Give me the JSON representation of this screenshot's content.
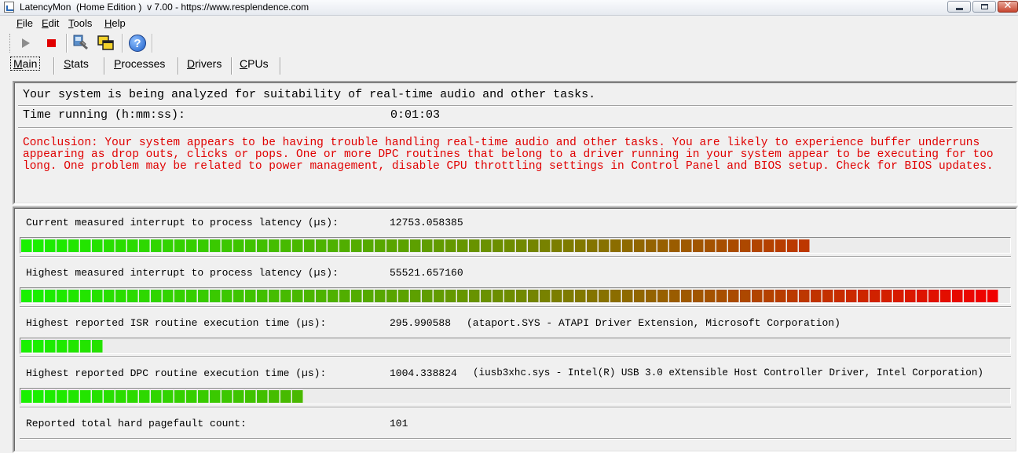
{
  "window": {
    "title": "LatencyMon  (Home Edition )  v 7.00 - https://www.resplendence.com",
    "controls": {
      "minimize": "minimize",
      "maximize": "maximize",
      "close": "✕"
    }
  },
  "menu": {
    "file": {
      "accel": "F",
      "rest": "ile"
    },
    "edit": {
      "accel": "E",
      "rest": "dit"
    },
    "tools": {
      "accel": "T",
      "rest": "ools"
    },
    "help": {
      "accel": "H",
      "rest": "elp"
    }
  },
  "toolbar": {
    "icons": [
      "play-icon",
      "stop-icon",
      "system-utilities-icon",
      "windows-icon",
      "help-icon"
    ],
    "help_glyph": "?"
  },
  "tabs": {
    "main": {
      "accel": "M",
      "rest": "ain"
    },
    "stats": {
      "accel": "S",
      "rest": "tats"
    },
    "processes": {
      "accel": "P",
      "rest": "rocesses"
    },
    "drivers": {
      "accel": "D",
      "rest": "rivers"
    },
    "cpus": {
      "accel": "C",
      "rest": "PUs"
    }
  },
  "status": {
    "analyzing": "Your system is being analyzed for suitability of real-time audio and other tasks.",
    "time_label": "Time running (h:mm:ss):",
    "time_value": "0:01:03"
  },
  "conclusion": "Conclusion: Your system appears to be having trouble handling real-time audio and other tasks. You are likely to experience buffer underruns appearing as drop outs, clicks or pops. One or more DPC routines that belong to a driver running in your system appear to be executing for too long. One problem may be related to power management, disable CPU throttling settings in Control Panel and BIOS setup. Check for BIOS updates.",
  "colors": {
    "conclusion_text": "#e00000",
    "bar_start": "#19f000",
    "bar_end": "#f00000",
    "stop_red": "#e10000"
  },
  "metrics": {
    "current_latency": {
      "label": "Current measured interrupt to process latency (µs):",
      "value": "12753.058385",
      "bar_fraction": 0.81
    },
    "highest_latency": {
      "label": "Highest measured interrupt to process latency (µs):",
      "value": "55521.657160",
      "bar_fraction": 1.0
    },
    "isr": {
      "label": "Highest reported ISR routine execution time (µs):",
      "value": "295.990588",
      "driver": "(ataport.SYS - ATAPI Driver Extension, Microsoft Corporation)",
      "bar_fraction": 0.087
    },
    "dpc": {
      "label": "Highest reported DPC routine execution time (µs):",
      "value": "1004.338824",
      "driver": "(iusb3xhc.sys - Intel(R) USB 3.0 eXtensible Host Controller Driver, Intel Corporation)",
      "bar_fraction": 0.29
    },
    "pagefault": {
      "label": "Reported total hard pagefault count:",
      "value": "101"
    }
  }
}
